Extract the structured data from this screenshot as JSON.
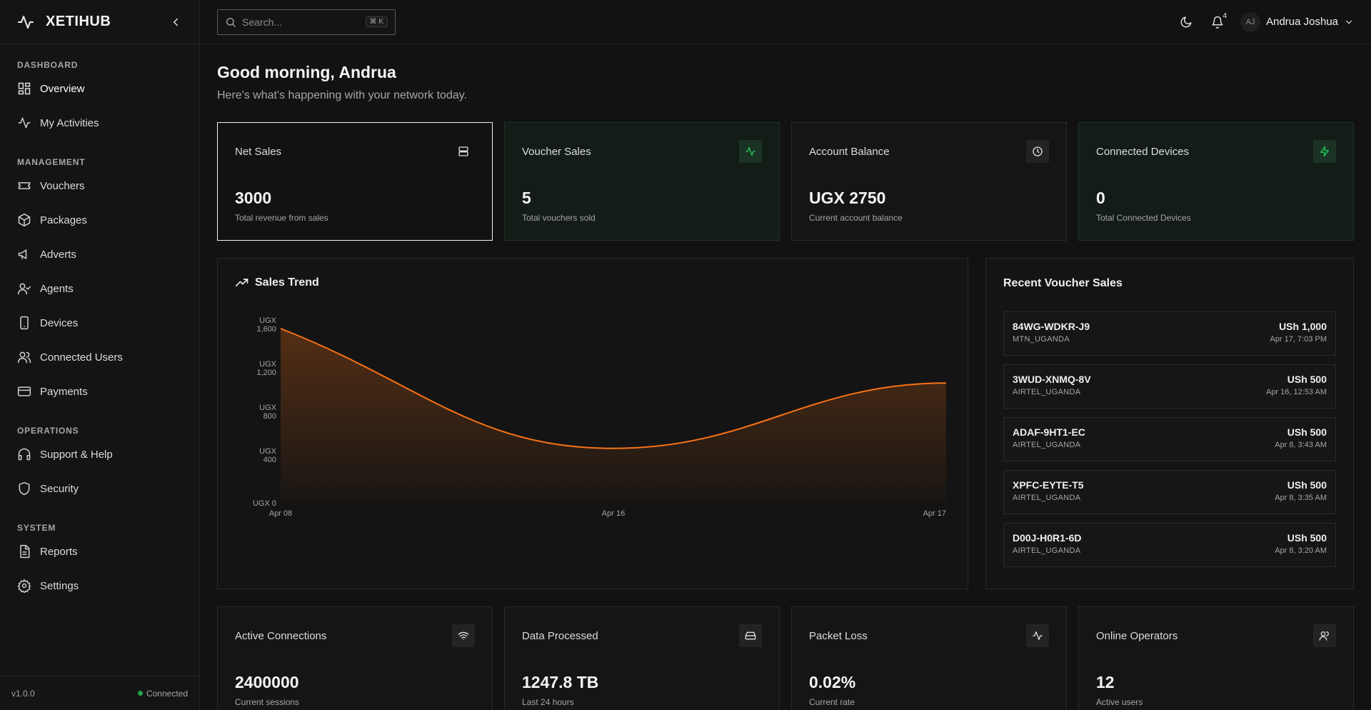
{
  "brand": {
    "name": "XETIHUB"
  },
  "sidebar": {
    "sections": [
      {
        "title": "DASHBOARD",
        "items": [
          {
            "label": "Overview",
            "icon": "grid-icon"
          },
          {
            "label": "My Activities",
            "icon": "activity-icon"
          }
        ]
      },
      {
        "title": "MANAGEMENT",
        "items": [
          {
            "label": "Vouchers",
            "icon": "ticket-icon"
          },
          {
            "label": "Packages",
            "icon": "package-icon"
          },
          {
            "label": "Adverts",
            "icon": "megaphone-icon"
          },
          {
            "label": "Agents",
            "icon": "user-check-icon"
          },
          {
            "label": "Devices",
            "icon": "device-icon"
          },
          {
            "label": "Connected Users",
            "icon": "users-icon"
          },
          {
            "label": "Payments",
            "icon": "credit-card-icon"
          }
        ]
      },
      {
        "title": "OPERATIONS",
        "items": [
          {
            "label": "Support & Help",
            "icon": "headphones-icon"
          },
          {
            "label": "Security",
            "icon": "shield-icon"
          }
        ]
      },
      {
        "title": "SYSTEM",
        "items": [
          {
            "label": "Reports",
            "icon": "file-icon"
          },
          {
            "label": "Settings",
            "icon": "gear-icon"
          }
        ]
      }
    ],
    "version": "v1.0.0",
    "connection_status": "Connected"
  },
  "topbar": {
    "search_placeholder": "Search...",
    "shortcut": "⌘ K",
    "notification_count": "4",
    "user_initials": "AJ",
    "user_name": "Andrua Joshua"
  },
  "header": {
    "greeting": "Good morning, Andrua",
    "subtitle": "Here's what's happening with your network today."
  },
  "stats": [
    {
      "title": "Net Sales",
      "value": "3000",
      "sub": "Total revenue from sales",
      "icon": "server-icon"
    },
    {
      "title": "Voucher Sales",
      "value": "5",
      "sub": "Total vouchers sold",
      "icon": "activity-icon"
    },
    {
      "title": "Account Balance",
      "value": "UGX 2750",
      "sub": "Current account balance",
      "icon": "clock-icon"
    },
    {
      "title": "Connected Devices",
      "value": "0",
      "sub": "Total Connected Devices",
      "icon": "zap-icon"
    }
  ],
  "chart_panel_title": "Sales Trend",
  "chart_data": {
    "type": "area",
    "title": "Sales Trend",
    "x": [
      "Apr 08",
      "Apr 16",
      "Apr 17"
    ],
    "values": [
      1600,
      500,
      1100
    ],
    "ylim": [
      0,
      1600
    ],
    "yticks": [
      0,
      400,
      800,
      1200,
      1600
    ],
    "ytick_labels": [
      "UGX 0",
      "UGX 400",
      "UGX 800",
      "UGX 1,200",
      "UGX 1,600"
    ],
    "color": "#f97316",
    "grid": false
  },
  "recent": {
    "title": "Recent Voucher Sales",
    "items": [
      {
        "code": "84WG-WDKR-J9",
        "network": "MTN_UGANDA",
        "amount": "USh 1,000",
        "time": "Apr 17, 7:03 PM"
      },
      {
        "code": "3WUD-XNMQ-8V",
        "network": "AIRTEL_UGANDA",
        "amount": "USh 500",
        "time": "Apr 16, 12:53 AM"
      },
      {
        "code": "ADAF-9HT1-EC",
        "network": "AIRTEL_UGANDA",
        "amount": "USh 500",
        "time": "Apr 8, 3:43 AM"
      },
      {
        "code": "XPFC-EYTE-T5",
        "network": "AIRTEL_UGANDA",
        "amount": "USh 500",
        "time": "Apr 8, 3:35 AM"
      },
      {
        "code": "D00J-H0R1-6D",
        "network": "AIRTEL_UGANDA",
        "amount": "USh 500",
        "time": "Apr 8, 3:20 AM"
      }
    ]
  },
  "stats2": [
    {
      "title": "Active Connections",
      "value": "2400000",
      "sub": "Current sessions",
      "icon": "wifi-icon"
    },
    {
      "title": "Data Processed",
      "value": "1247.8 TB",
      "sub": "Last 24 hours",
      "icon": "hard-drive-icon"
    },
    {
      "title": "Packet Loss",
      "value": "0.02%",
      "sub": "Current rate",
      "icon": "activity-icon"
    },
    {
      "title": "Online Operators",
      "value": "12",
      "sub": "Active users",
      "icon": "users-icon"
    }
  ],
  "colors": {
    "accent_orange": "#f97316",
    "accent_green": "#22c55e"
  }
}
